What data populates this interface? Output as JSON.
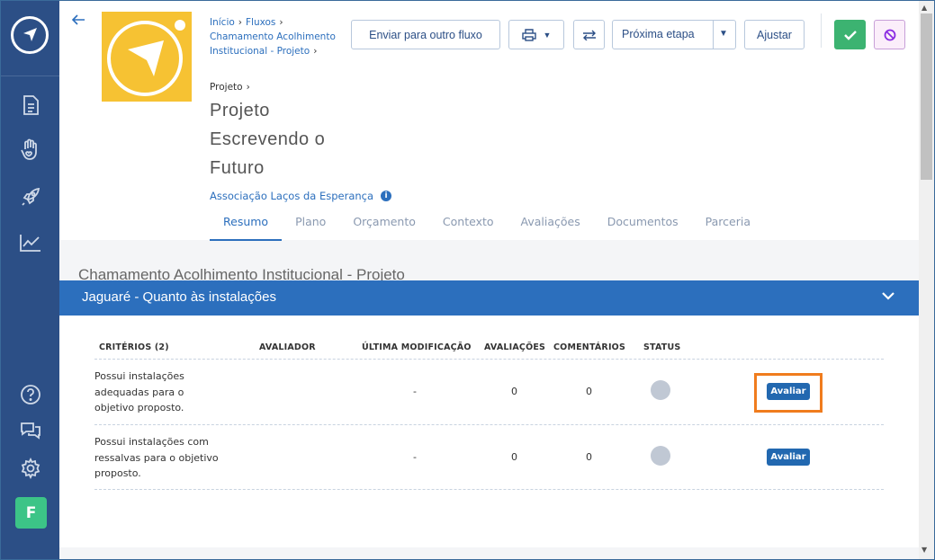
{
  "sidebar": {
    "items": [
      {
        "icon": "document-icon"
      },
      {
        "icon": "hand-heart-icon"
      },
      {
        "icon": "rocket-icon"
      },
      {
        "icon": "chart-line-icon"
      }
    ],
    "bottom": [
      {
        "icon": "help-icon"
      },
      {
        "icon": "chat-icon"
      },
      {
        "icon": "gear-icon"
      }
    ],
    "avatar_letter": "F"
  },
  "breadcrumb": {
    "items": [
      "Início",
      "Fluxos",
      "Chamamento Acolhimento Institucional - Projeto"
    ],
    "current": "Projeto"
  },
  "project": {
    "title": "Projeto Escrevendo o Futuro",
    "organization": "Associação Laços da Esperança"
  },
  "toolbar": {
    "send_label": "Enviar para outro fluxo",
    "next_label": "Próxima etapa",
    "adjust_label": "Ajustar"
  },
  "tabs": [
    {
      "label": "Resumo",
      "active": true
    },
    {
      "label": "Plano"
    },
    {
      "label": "Orçamento"
    },
    {
      "label": "Contexto"
    },
    {
      "label": "Avaliações"
    },
    {
      "label": "Documentos"
    },
    {
      "label": "Parceria"
    }
  ],
  "section": {
    "title": "Chamamento Acolhimento Institucional - Projeto",
    "group_title": "Jaguaré - Quanto às instalações"
  },
  "table": {
    "headers": [
      "CRITÉRIOS (2)",
      "AVALIADOR",
      "ÚLTIMA MODIFICAÇÃO",
      "AVALIAÇÕES",
      "COMENTÁRIOS",
      "STATUS"
    ],
    "rows": [
      {
        "criteria": "Possui instalações adequadas para o objetivo proposto.",
        "evaluator": "",
        "last_modified": "-",
        "evaluations": "0",
        "comments": "0",
        "action": "Avaliar"
      },
      {
        "criteria": "Possui instalações com ressalvas para o objetivo proposto.",
        "evaluator": "",
        "last_modified": "-",
        "evaluations": "0",
        "comments": "0",
        "action": "Avaliar"
      }
    ]
  },
  "colors": {
    "sidebar": "#2c4f86",
    "accent": "#2c6fbd",
    "approve": "#3cb371",
    "highlight": "#f07c1e",
    "logo_bg": "#f6c233"
  }
}
